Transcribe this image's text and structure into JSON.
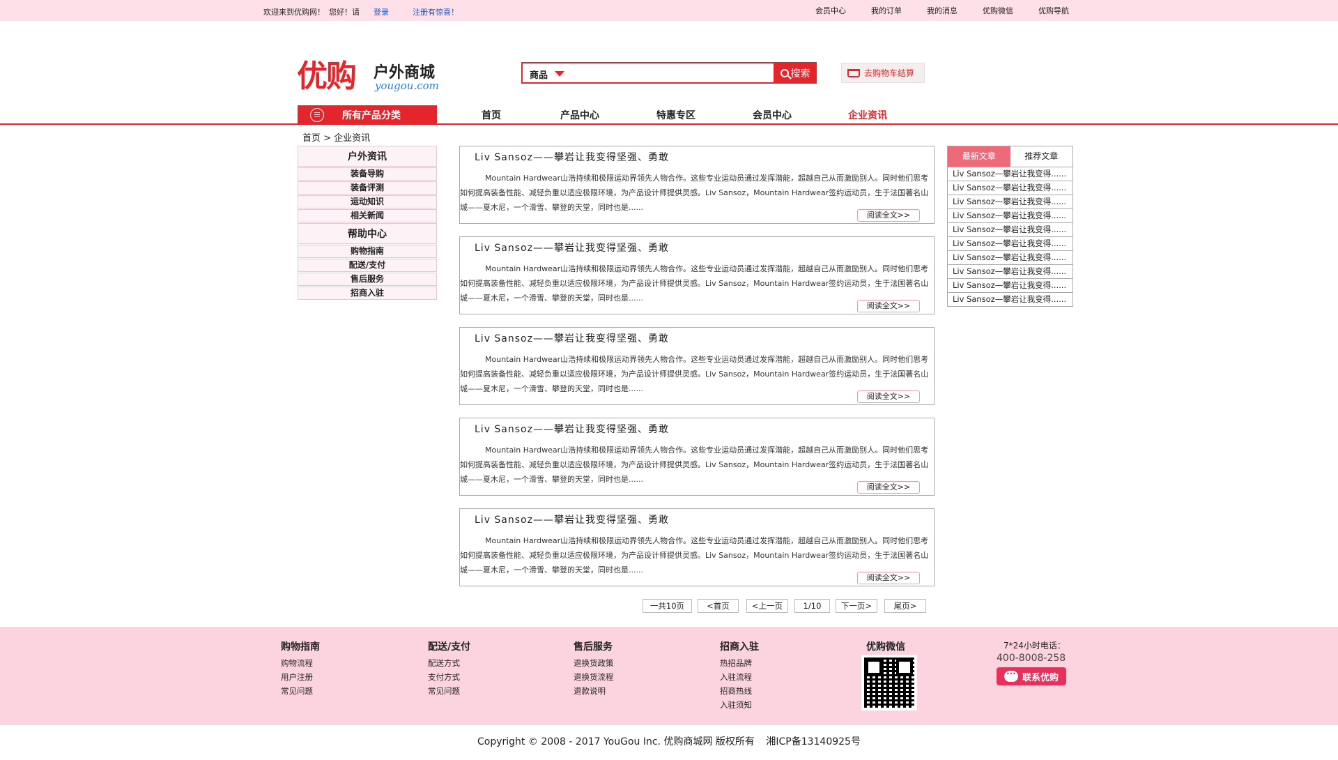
{
  "topbar": {
    "welcome": "欢迎来到优购网！",
    "hello": "您好！请",
    "login": "登录",
    "register": "注册有惊喜！",
    "links": [
      "会员中心",
      "我的订单",
      "我的消息",
      "优购微信",
      "优购导航"
    ]
  },
  "logo": {
    "big": "优购",
    "cn": "户外商城",
    "en": "yougou.com"
  },
  "search": {
    "category": "商品",
    "button": "搜索",
    "placeholder": ""
  },
  "cart": {
    "label": "去购物车结算"
  },
  "nav": {
    "all_categories": "所有产品分类",
    "items": [
      "首页",
      "产品中心",
      "特惠专区",
      "会员中心",
      "企业资讯"
    ]
  },
  "breadcrumb": "首页 > 企业资讯",
  "sidebar": {
    "sections": [
      {
        "title": "户外资讯",
        "items": [
          "装备导购",
          "装备评测",
          "运动知识",
          "相关新闻"
        ]
      },
      {
        "title": "帮助中心",
        "items": [
          "购物指南",
          "配送/支付",
          "售后服务",
          "招商入驻"
        ]
      }
    ]
  },
  "articles": [
    {
      "title": "Liv Sansoz——攀岩让我变得坚强、勇敢",
      "body": "Mountain Hardwear山浩持续和极限运动界领先人物合作。这些专业运动员通过发挥潜能，超越自己从而激励别人。同时他们思考如何提高装备性能、减轻负重以适应极限环境，为产品设计师提供灵感。Liv Sansoz，Mountain Hardwear签约运动员，生于法国著名山城——夏木尼，一个滑雪、攀登的天堂，同时也是......",
      "more": "阅读全文>>"
    },
    {
      "title": "Liv Sansoz——攀岩让我变得坚强、勇敢",
      "body": "Mountain Hardwear山浩持续和极限运动界领先人物合作。这些专业运动员通过发挥潜能，超越自己从而激励别人。同时他们思考如何提高装备性能、减轻负重以适应极限环境，为产品设计师提供灵感。Liv Sansoz，Mountain Hardwear签约运动员，生于法国著名山城——夏木尼，一个滑雪、攀登的天堂，同时也是......",
      "more": "阅读全文>>"
    },
    {
      "title": "Liv Sansoz——攀岩让我变得坚强、勇敢",
      "body": "Mountain Hardwear山浩持续和极限运动界领先人物合作。这些专业运动员通过发挥潜能，超越自己从而激励别人。同时他们思考如何提高装备性能、减轻负重以适应极限环境，为产品设计师提供灵感。Liv Sansoz，Mountain Hardwear签约运动员，生于法国著名山城——夏木尼，一个滑雪、攀登的天堂，同时也是......",
      "more": "阅读全文>>"
    },
    {
      "title": "Liv Sansoz——攀岩让我变得坚强、勇敢",
      "body": "Mountain Hardwear山浩持续和极限运动界领先人物合作。这些专业运动员通过发挥潜能，超越自己从而激励别人。同时他们思考如何提高装备性能、减轻负重以适应极限环境，为产品设计师提供灵感。Liv Sansoz，Mountain Hardwear签约运动员，生于法国著名山城——夏木尼，一个滑雪、攀登的天堂，同时也是......",
      "more": "阅读全文>>"
    },
    {
      "title": "Liv Sansoz——攀岩让我变得坚强、勇敢",
      "body": "Mountain Hardwear山浩持续和极限运动界领先人物合作。这些专业运动员通过发挥潜能，超越自己从而激励别人。同时他们思考如何提高装备性能、减轻负重以适应极限环境，为产品设计师提供灵感。Liv Sansoz，Mountain Hardwear签约运动员，生于法国著名山城——夏木尼，一个滑雪、攀登的天堂，同时也是......",
      "more": "阅读全文>>"
    }
  ],
  "right_panel": {
    "tabs": [
      "最新文章",
      "推荐文章"
    ],
    "items": [
      "Liv Sansoz—攀岩让我变得......",
      "Liv Sansoz—攀岩让我变得......",
      "Liv Sansoz—攀岩让我变得......",
      "Liv Sansoz—攀岩让我变得......",
      "Liv Sansoz—攀岩让我变得......",
      "Liv Sansoz—攀岩让我变得......",
      "Liv Sansoz—攀岩让我变得......",
      "Liv Sansoz—攀岩让我变得......",
      "Liv Sansoz—攀岩让我变得......",
      "Liv Sansoz—攀岩让我变得......"
    ]
  },
  "pager": {
    "total": "一共10页",
    "first": "<首页",
    "prev": "<上一页",
    "current": "1/10",
    "next": "下一页>",
    "last": "尾页>"
  },
  "footer": {
    "cols": [
      {
        "title": "购物指南",
        "links": [
          "购物流程",
          "用户注册",
          "常见问题"
        ]
      },
      {
        "title": "配送/支付",
        "links": [
          "配送方式",
          "支付方式",
          "常见问题"
        ]
      },
      {
        "title": "售后服务",
        "links": [
          "退换货政策",
          "退换货流程",
          "退款说明"
        ]
      },
      {
        "title": "招商入驻",
        "links": [
          "热招品牌",
          "入驻流程",
          "招商热线",
          "入驻须知"
        ]
      }
    ],
    "wechat_title": "优购微信",
    "phone_label": "7*24小时电话：",
    "phone": "400-8008-258",
    "contact": "联系优购"
  },
  "copyright": {
    "text": "Copyright © 2008 - 2017 YouGou Inc. 优购商城网  版权所有",
    "icp": "湘ICP备13140925号"
  }
}
